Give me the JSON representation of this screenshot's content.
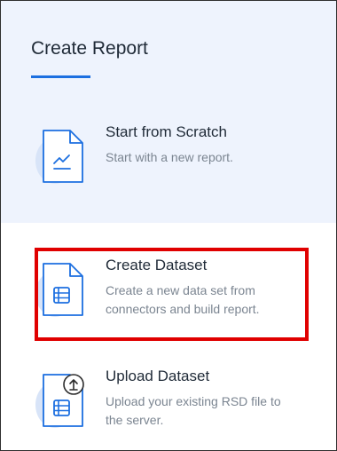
{
  "dialog": {
    "title": "Create Report"
  },
  "options": [
    {
      "title": "Start from Scratch",
      "description": "Start with a new report.",
      "icon": "report-chart-icon"
    },
    {
      "title": "Create Dataset",
      "description": "Create a new data set from connectors and build report.",
      "icon": "dataset-icon"
    },
    {
      "title": "Upload Dataset",
      "description": "Upload your existing RSD file to the server.",
      "icon": "upload-dataset-icon"
    }
  ],
  "colors": {
    "accent": "#1c6fe0",
    "icon_blob": "#d8e4f8",
    "top_bg": "#eef3fd",
    "highlight": "#e00000",
    "text_primary": "#1f2a37",
    "text_secondary": "#7b8591"
  }
}
